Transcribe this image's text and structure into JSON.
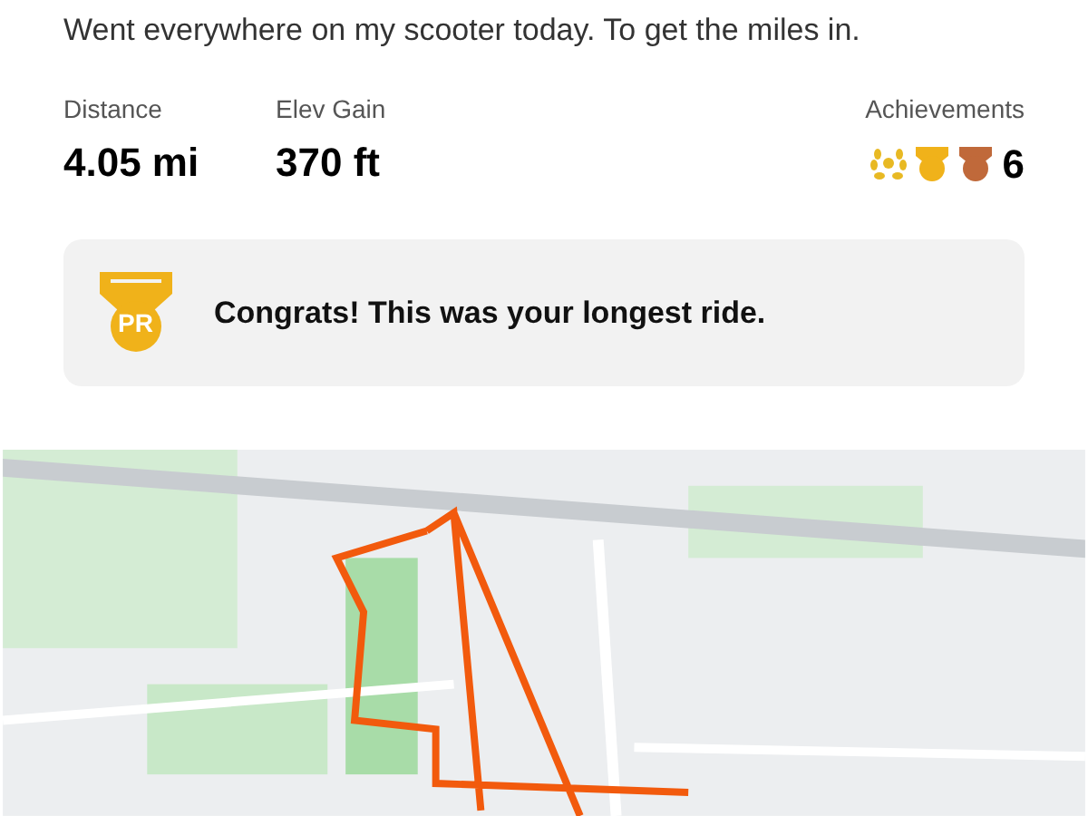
{
  "description": "Went everywhere on my scooter today. To get the miles in.",
  "stats": [
    {
      "label": "Distance",
      "value": "4.05 mi"
    },
    {
      "label": "Elev Gain",
      "value": "370 ft"
    }
  ],
  "achievements": {
    "label": "Achievements",
    "icons": [
      {
        "kind": "laurel",
        "color": "#e8b923"
      },
      {
        "kind": "medal",
        "color": "#f0b21a"
      },
      {
        "kind": "medal",
        "color": "#c0693a"
      }
    ],
    "count": "6"
  },
  "pr_card": {
    "badge": "PR",
    "message": "Congrats! This was your longest ride."
  }
}
